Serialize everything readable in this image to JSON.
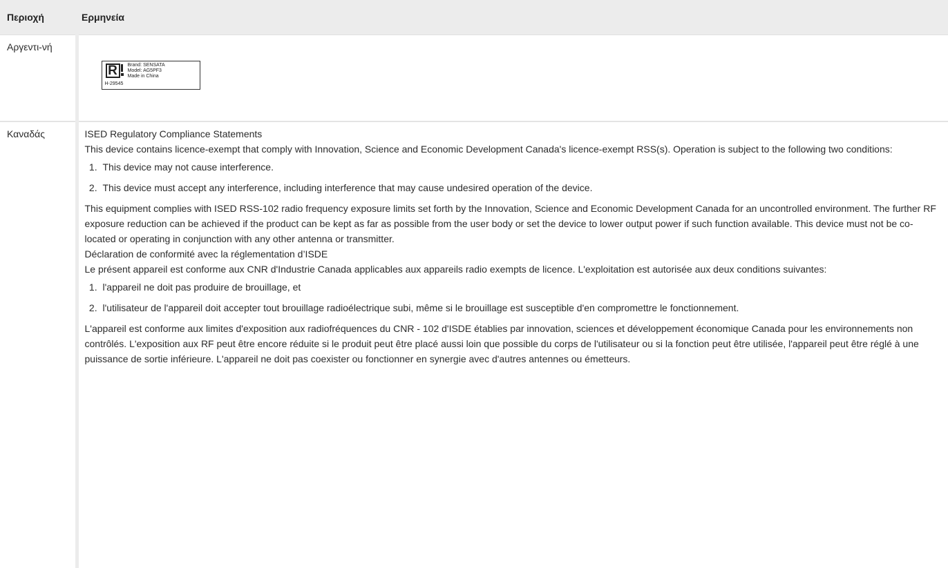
{
  "header": {
    "col_region": "Περιοχή",
    "col_interpretation": "Ερμηνεία"
  },
  "argentina": {
    "region": "Αργεντι-νή",
    "label": {
      "brand": "Brand: SENSATA",
      "model": "Model: AG5PF3",
      "made": "Made in China",
      "code": "H-29545"
    }
  },
  "canada": {
    "region": "Καναδάς",
    "en_title": "ISED Regulatory Compliance Statements",
    "en_intro": "This device contains licence-exempt that comply with Innovation, Science and Economic Development Canada's licence-exempt RSS(s). Operation is subject to the following two conditions:",
    "en_items": [
      "This device may not cause interference.",
      "This device must accept any interference, including interference that may cause undesired operation of the device."
    ],
    "en_exposure": "This equipment complies with ISED RSS-102 radio frequency exposure limits set forth by the Innovation, Science and Economic Development Canada for an uncontrolled environment. The further RF exposure reduction can be achieved if the product can be kept as far as possible from the user body or set the device to lower output power if such function available. This device must not be co-located or operating in conjunction with any other antenna or transmitter.",
    "fr_title": "Déclaration de conformité avec la réglementation d’ISDE",
    "fr_intro": "Le présent appareil est conforme aux CNR d'Industrie Canada applicables aux appareils radio exempts de licence. L'exploitation est autorisée aux deux conditions suivantes:",
    "fr_items": [
      "l'appareil ne doit pas produire de brouillage, et",
      "l'utilisateur de l'appareil doit accepter tout brouillage radioélectrique subi, même si le brouillage est susceptible d'en compromettre le fonctionnement."
    ],
    "fr_exposure": "L'appareil est conforme aux limites d'exposition aux radiofréquences du CNR - 102 d'ISDE établies par innovation, sciences et développement économique Canada pour les environnements non contrôlés. L'exposition aux RF peut être encore réduite si le produit peut être placé aussi loin que possible du corps de l'utilisateur ou si la fonction peut être utilisée, l'appareil peut être réglé à une puissance de sortie inférieure. L'appareil ne doit pas coexister ou fonctionner en synergie avec d'autres antennes ou émetteurs."
  }
}
